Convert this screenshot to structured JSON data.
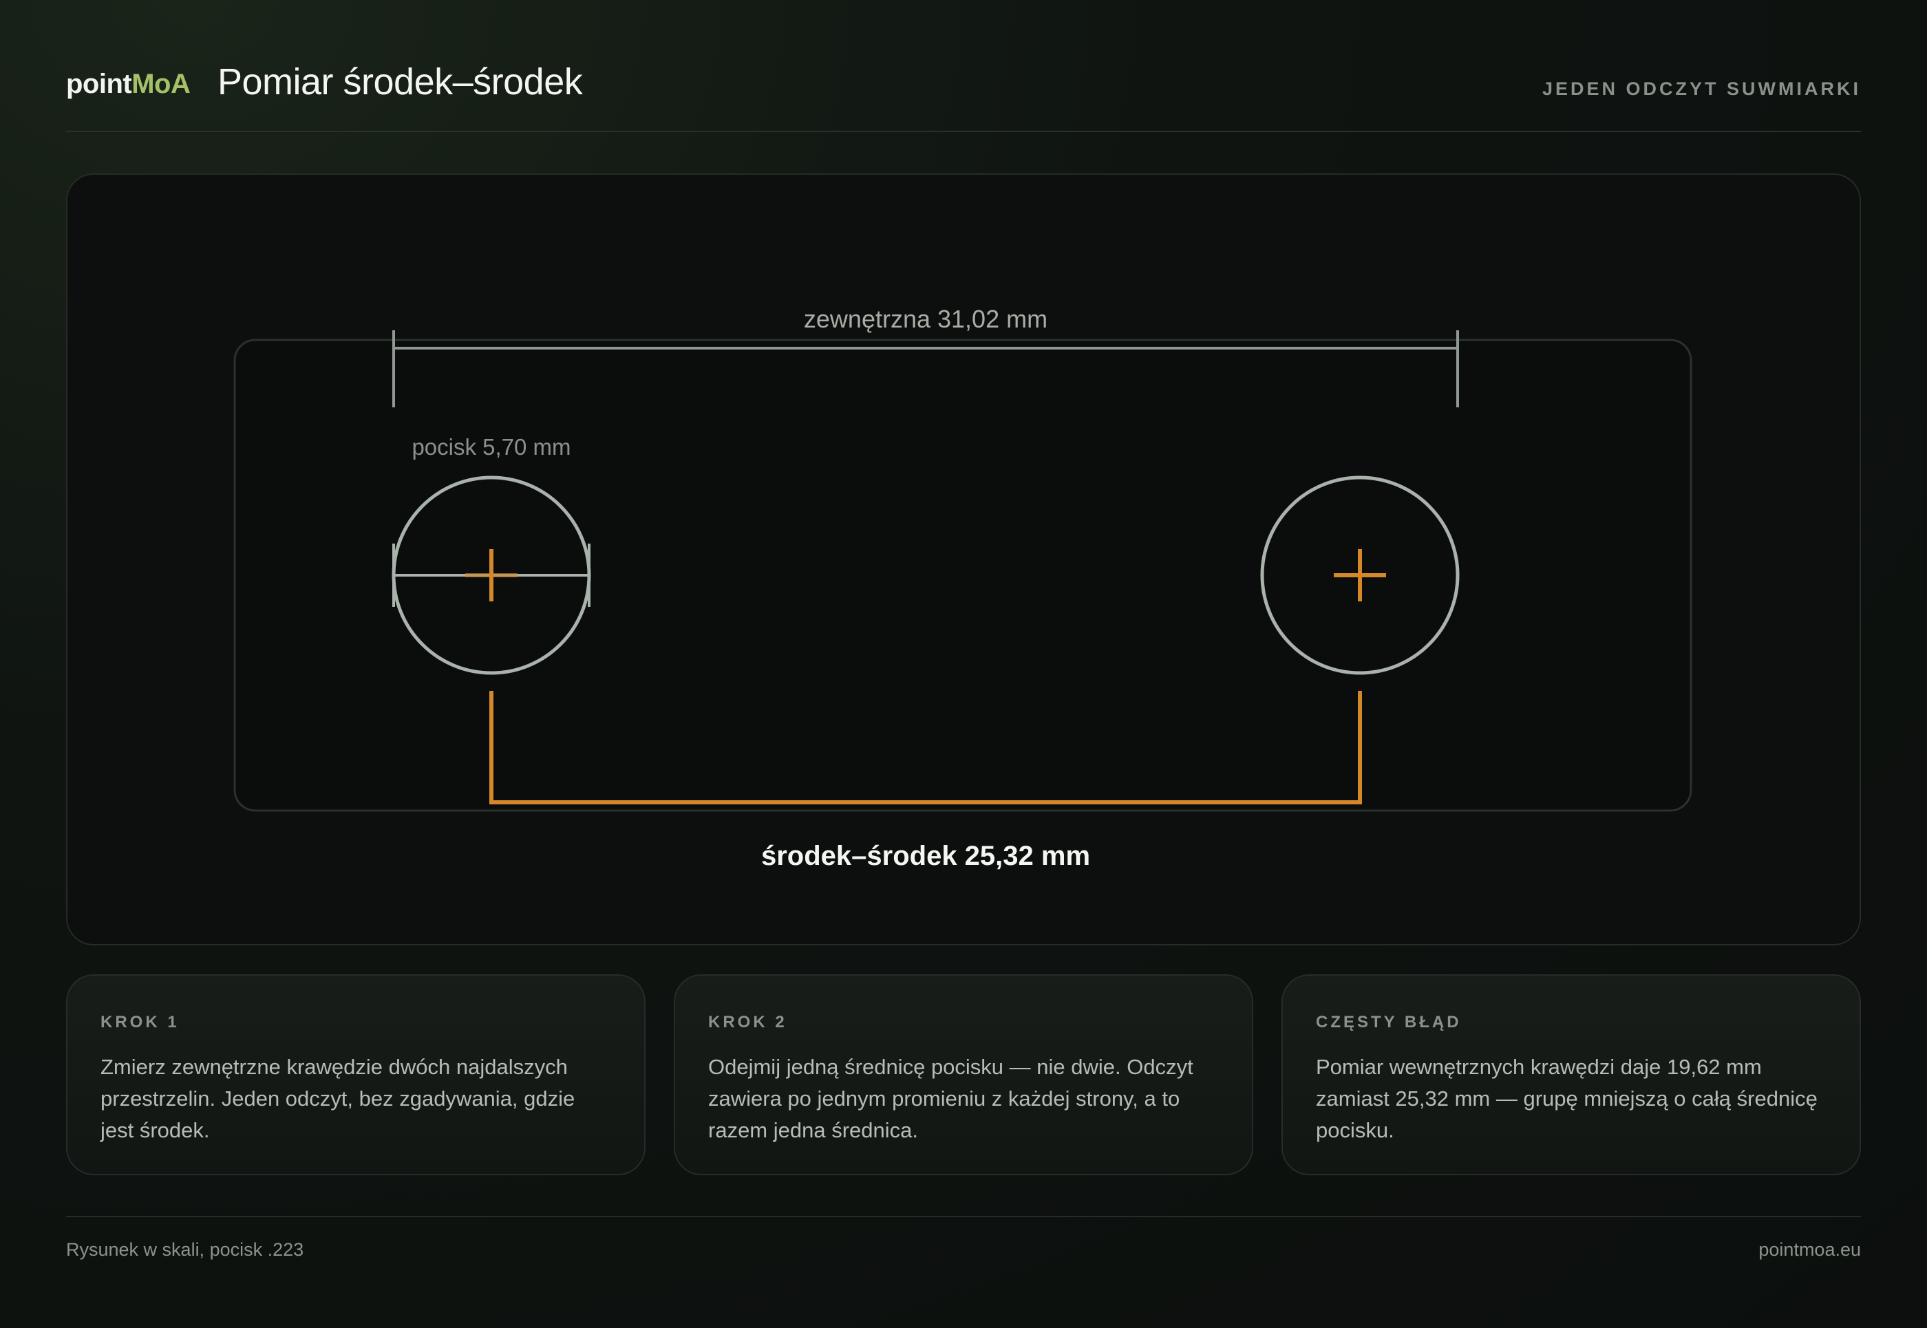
{
  "brand": {
    "part1": "point",
    "part2": "MoA"
  },
  "header": {
    "title": "Pomiar środek–środek",
    "tagline": "JEDEN ODCZYT SUWMIARKI"
  },
  "diagram": {
    "outer_label": "zewnętrzna 31,02 mm",
    "bullet_label": "pocisk 5,70 mm",
    "ctc_label": "środek–środek 25,32 mm",
    "outer_mm": 31.02,
    "bullet_mm": 5.7,
    "ctc_mm": 25.32,
    "colors": {
      "accent": "#d4882a",
      "hole": "#a9b2ab",
      "dim": "#8f9891",
      "target_border": "#2b312c",
      "target_fill": "#0b0d0c"
    }
  },
  "steps": [
    {
      "title": "KROK 1",
      "text": "Zmierz zewnętrzne krawędzie dwóch najdalszych przestrzelin. Jeden odczyt, bez zgadywania, gdzie jest środek."
    },
    {
      "title": "KROK 2",
      "text": "Odejmij jedną średnicę pocisku — nie dwie. Odczyt zawiera po jednym promieniu z każdej strony, a to razem jedna średnica."
    },
    {
      "title": "CZĘSTY BŁĄD",
      "text": "Pomiar wewnętrznych krawędzi daje 19,62 mm zamiast 25,32 mm — grupę mniejszą o całą średnicę pocisku."
    }
  ],
  "footer": {
    "left": "Rysunek w skali, pocisk .223",
    "right": "pointmoa.eu"
  }
}
